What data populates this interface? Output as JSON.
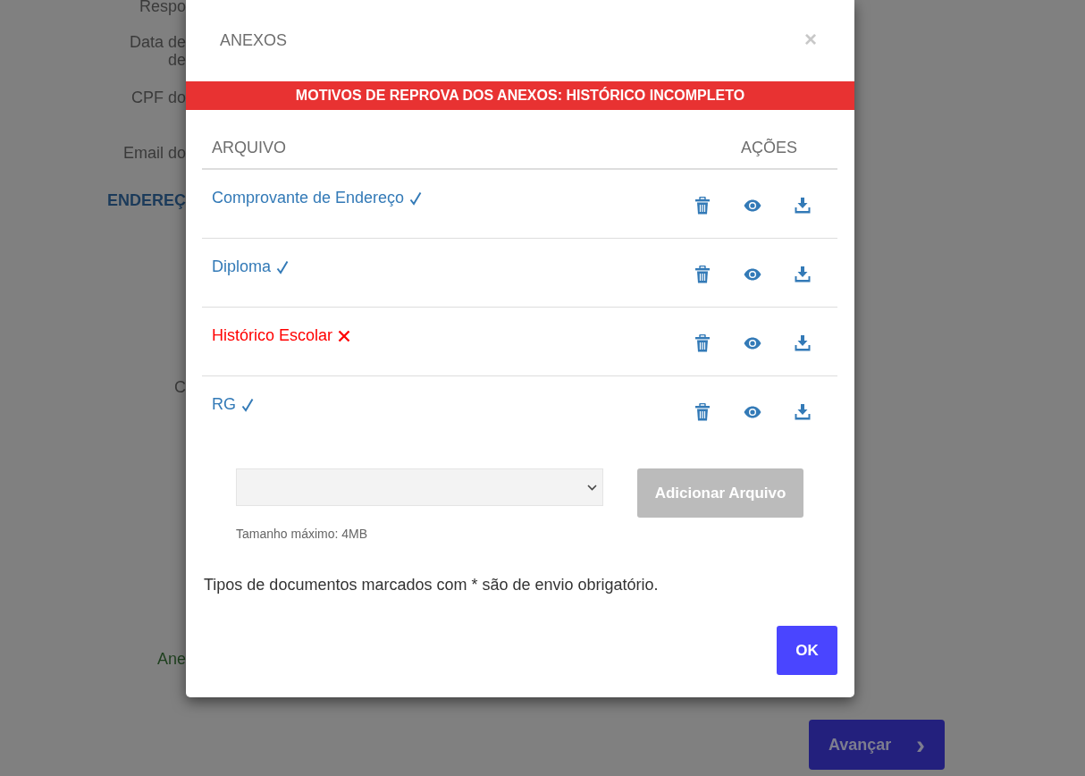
{
  "background_form": {
    "labels": [
      {
        "text": "Respo",
        "kind": "field"
      },
      {
        "text": "Data de",
        "kind": "field"
      },
      {
        "text": "de",
        "kind": "field"
      },
      {
        "text": "CPF do",
        "kind": "field"
      },
      {
        "text": "Email do",
        "kind": "field"
      },
      {
        "text": "ENDEREÇ",
        "kind": "section"
      },
      {
        "text": "C",
        "kind": "field"
      },
      {
        "text": "Ane",
        "kind": "attachment"
      }
    ],
    "next_button": {
      "label": "Avançar",
      "icon": "›"
    }
  },
  "modal": {
    "title": "ANEXOS",
    "close": "×",
    "alert": "MOTIVOS DE REPROVA DOS ANEXOS: HISTÓRICO INCOMPLETO",
    "table": {
      "columns": [
        "ARQUIVO",
        "AÇÕES"
      ],
      "rows": [
        {
          "name": "Comprovante de Endereço",
          "kind": "approved"
        },
        {
          "name": "Diploma",
          "kind": "approved"
        },
        {
          "name": "Histórico Escolar",
          "kind": "rejected"
        },
        {
          "name": "RG",
          "kind": "approved"
        }
      ]
    },
    "file_select": {
      "disabled": false
    },
    "add_button": {
      "label": "Adicionar Arquivo",
      "disabled": true
    },
    "size_hint": "Tamanho máximo: 4MB",
    "note": "Tipos de documentos marcados com * são de envio obrigatório.",
    "ok_button": "OK"
  }
}
